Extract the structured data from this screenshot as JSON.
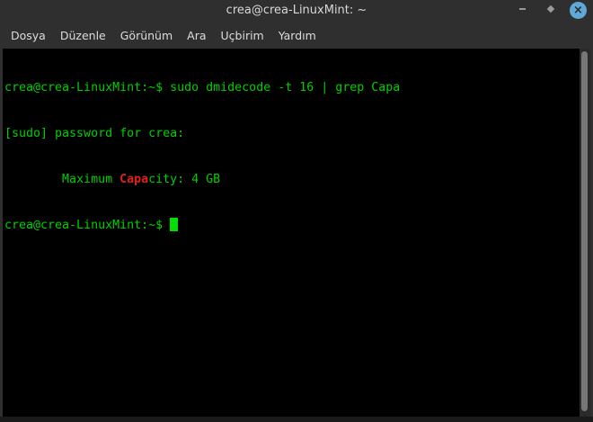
{
  "window": {
    "title": "crea@crea-LinuxMint: ~",
    "close_glyph": "×"
  },
  "menu": [
    "Dosya",
    "Düzenle",
    "Görünüm",
    "Ara",
    "Uçbirim",
    "Yardım"
  ],
  "terminal": {
    "line1": "crea@crea-LinuxMint:~$ sudo dmidecode -t 16 | grep Capa",
    "line2": "[sudo] password for crea:",
    "line3_prefix": "        Maximum ",
    "line3_match": "Capa",
    "line3_suffix": "city: 4 GB",
    "prompt": "crea@crea-LinuxMint:~$ "
  },
  "colors": {
    "text": "#00d000",
    "match": "#e02020",
    "close": "#5fa8d8"
  }
}
